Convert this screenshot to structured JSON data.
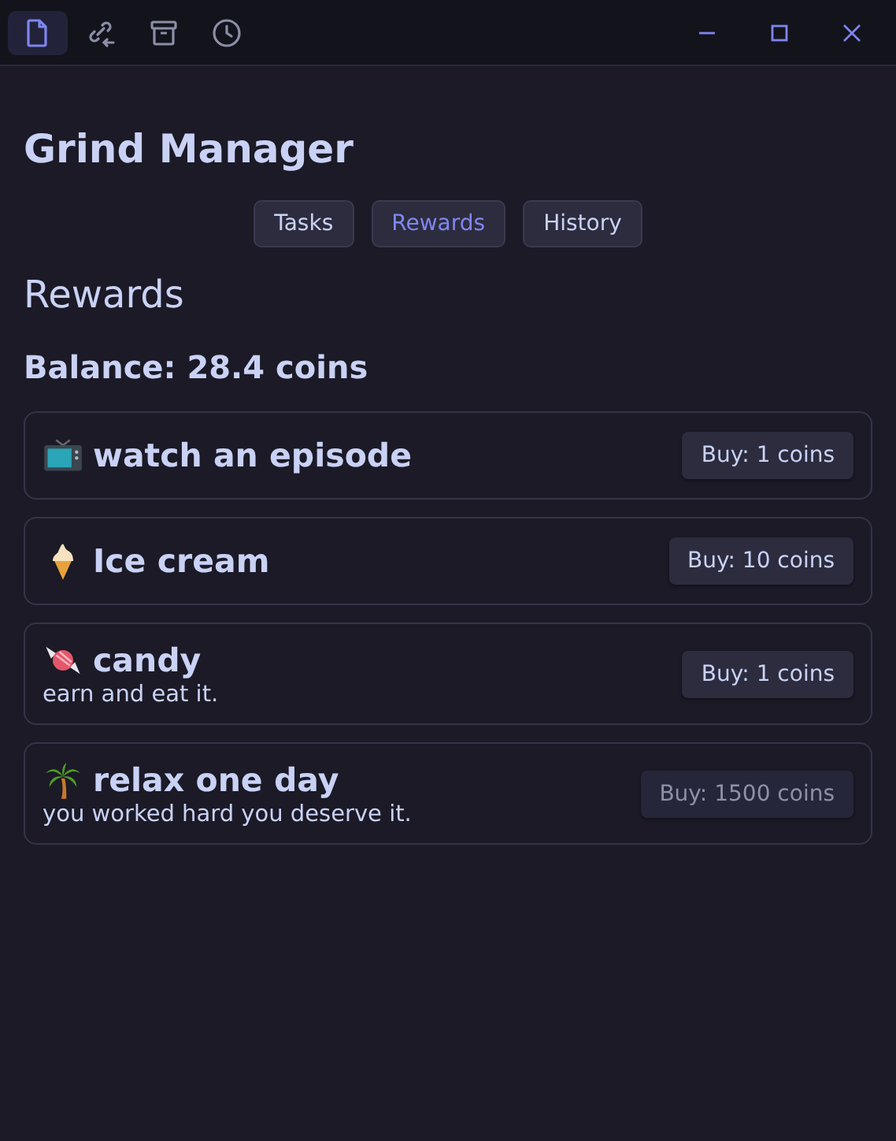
{
  "toolbar": {
    "items": [
      {
        "kind": "file",
        "selected": true
      },
      {
        "kind": "link",
        "selected": false
      },
      {
        "kind": "archive",
        "selected": false
      },
      {
        "kind": "clock",
        "selected": false
      }
    ]
  },
  "title": "Grind Manager",
  "tabs": [
    {
      "label": "Tasks",
      "selected": false
    },
    {
      "label": "Rewards",
      "selected": true
    },
    {
      "label": "History",
      "selected": false
    }
  ],
  "section_title": "Rewards",
  "balance": "Balance: 28.4 coins",
  "rewards": [
    {
      "kind": "tv",
      "name": "watch an episode",
      "button": "Buy: 1 coins",
      "disabled": false
    },
    {
      "kind": "ice_cream",
      "name": "Ice cream",
      "button": "Buy: 10 coins",
      "disabled": false
    },
    {
      "kind": "candy",
      "name": "candy",
      "description": "earn and eat it.",
      "button": "Buy: 1 coins",
      "disabled": false
    },
    {
      "kind": "palm",
      "name": "relax one day",
      "description": "you worked hard you deserve it.",
      "button": "Buy: 1500 coins",
      "disabled": true
    }
  ]
}
